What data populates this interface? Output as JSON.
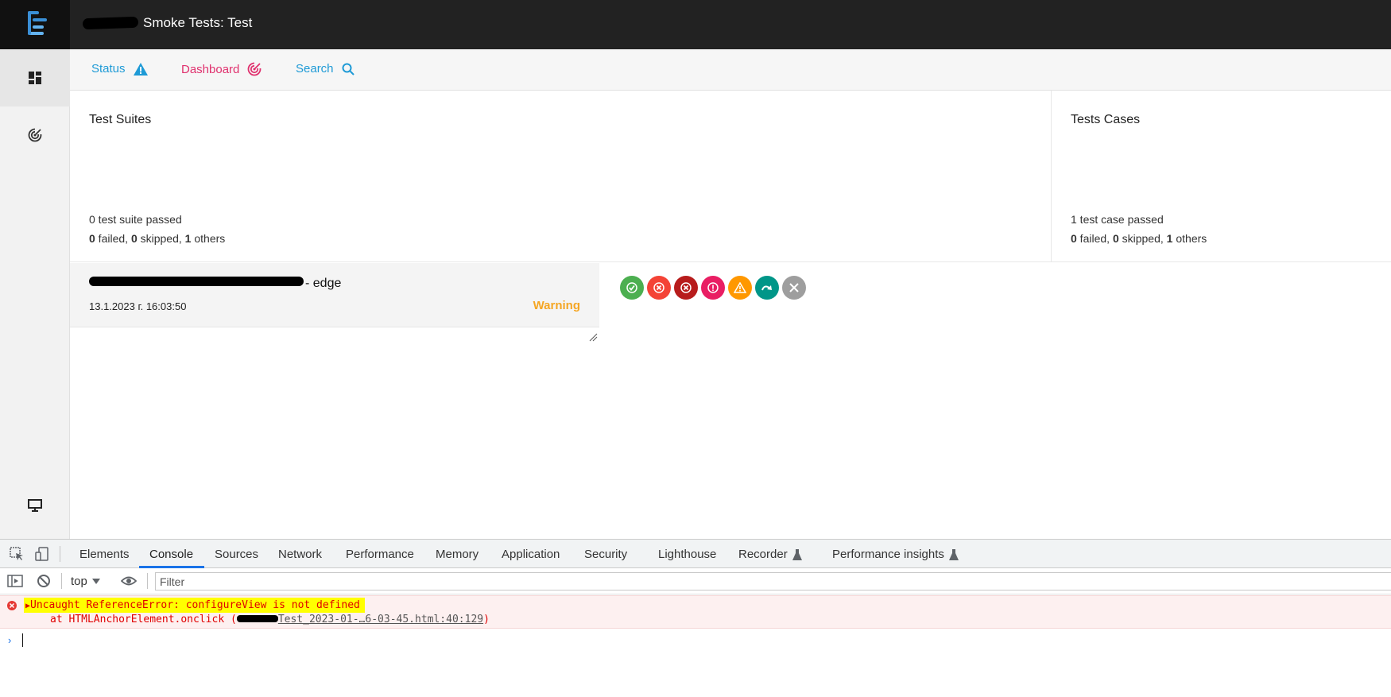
{
  "app": {
    "title": "Smoke Tests: Test"
  },
  "nav": {
    "tabs": [
      {
        "label": "Status",
        "icon": "warning-triangle-icon",
        "color": "#1e9ad6"
      },
      {
        "label": "Dashboard",
        "icon": "target-icon",
        "color": "#e0316e"
      },
      {
        "label": "Search",
        "icon": "search-icon",
        "color": "#1e9ad6"
      }
    ]
  },
  "sidebar": {
    "items": [
      {
        "icon": "dashboard-grid-icon"
      },
      {
        "icon": "target-icon"
      },
      {
        "icon": "monitor-icon"
      }
    ]
  },
  "suites": {
    "title": "Test Suites",
    "passed_text": "0 test suite passed",
    "failed": "0",
    "skipped": "0",
    "others": "1",
    "failed_label": " failed, ",
    "skipped_label": " skipped, ",
    "others_label": " others"
  },
  "cases": {
    "title": "Tests Cases",
    "passed_text": "1 test case passed",
    "failed": "0",
    "skipped": "0",
    "others": "1",
    "failed_label": " failed, ",
    "skipped_label": " skipped, ",
    "others_label": " others"
  },
  "run": {
    "name_suffix": "- edge",
    "date": "13.1.2023 г. 16:03:50",
    "status": "Warning",
    "status_color": "#f5a623"
  },
  "filters": [
    {
      "name": "passed",
      "icon": "check-icon",
      "color": "#4caf50"
    },
    {
      "name": "failed",
      "icon": "x-icon",
      "color": "#f44336"
    },
    {
      "name": "error",
      "icon": "x-icon",
      "color": "#b71c1c"
    },
    {
      "name": "fatal",
      "icon": "exclamation-icon",
      "color": "#e91e63"
    },
    {
      "name": "warning",
      "icon": "warning-triangle-icon",
      "color": "#ff9800"
    },
    {
      "name": "skipped",
      "icon": "skip-arrow-icon",
      "color": "#009688"
    },
    {
      "name": "clear",
      "icon": "close-icon",
      "color": "#9e9e9e"
    }
  ],
  "devtools": {
    "tabs": [
      "Elements",
      "Console",
      "Sources",
      "Network",
      "Performance",
      "Memory",
      "Application",
      "Security",
      "Lighthouse",
      "Recorder",
      "Performance insights"
    ],
    "active_tab": "Console",
    "context": "top",
    "filter_placeholder": "Filter",
    "error": {
      "message": "Uncaught ReferenceError: configureView is not defined",
      "location_prefix": "at HTMLAnchorElement.onclick (",
      "location_link": "Test_2023-01-…6-03-45.html:40:129",
      "location_suffix": ")"
    },
    "prompt_symbol": "›"
  }
}
